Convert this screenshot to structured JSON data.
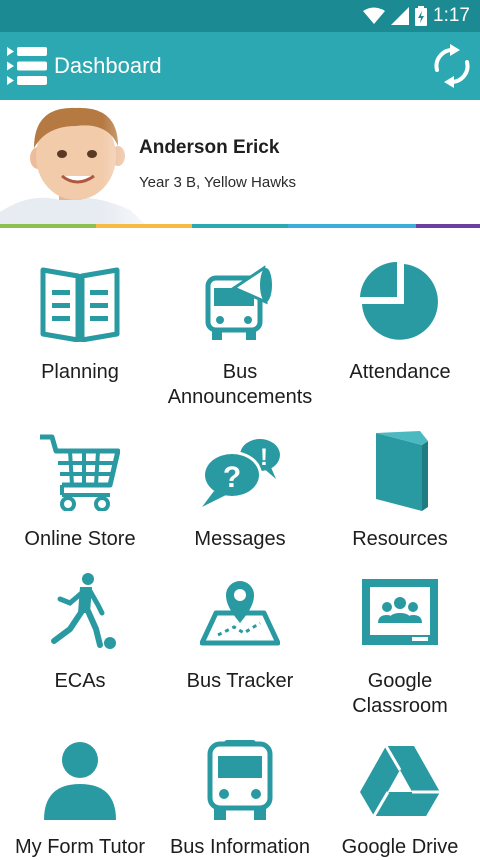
{
  "status_bar": {
    "time": "1:17"
  },
  "app_bar": {
    "title": "Dashboard"
  },
  "profile": {
    "name": "Anderson Erick",
    "class": "Year 3 B, Yellow Hawks"
  },
  "colors": {
    "primary": "#2ba8b1",
    "status": "#1b8a93",
    "icon": "#2a9aa2",
    "strip": [
      "#8cc152",
      "#f6bb42",
      "#2ba8b1",
      "#3bafda",
      "#6b3fa0"
    ]
  },
  "tiles": [
    {
      "label": "Planning",
      "icon": "book-icon"
    },
    {
      "label": "Bus\nAnnouncements",
      "icon": "bus-megaphone-icon"
    },
    {
      "label": "Attendance",
      "icon": "pie-chart-icon"
    },
    {
      "label": "Online Store",
      "icon": "shopping-cart-icon"
    },
    {
      "label": "Messages",
      "icon": "speech-bubbles-icon"
    },
    {
      "label": "Resources",
      "icon": "closed-book-icon"
    },
    {
      "label": "ECAs",
      "icon": "soccer-player-icon"
    },
    {
      "label": "Bus Tracker",
      "icon": "map-pin-icon"
    },
    {
      "label": "Google\nClassroom",
      "icon": "classroom-board-icon"
    },
    {
      "label": "My Form Tutor",
      "icon": "person-icon"
    },
    {
      "label": "Bus Information",
      "icon": "bus-icon"
    },
    {
      "label": "Google Drive",
      "icon": "drive-triangle-icon"
    }
  ]
}
